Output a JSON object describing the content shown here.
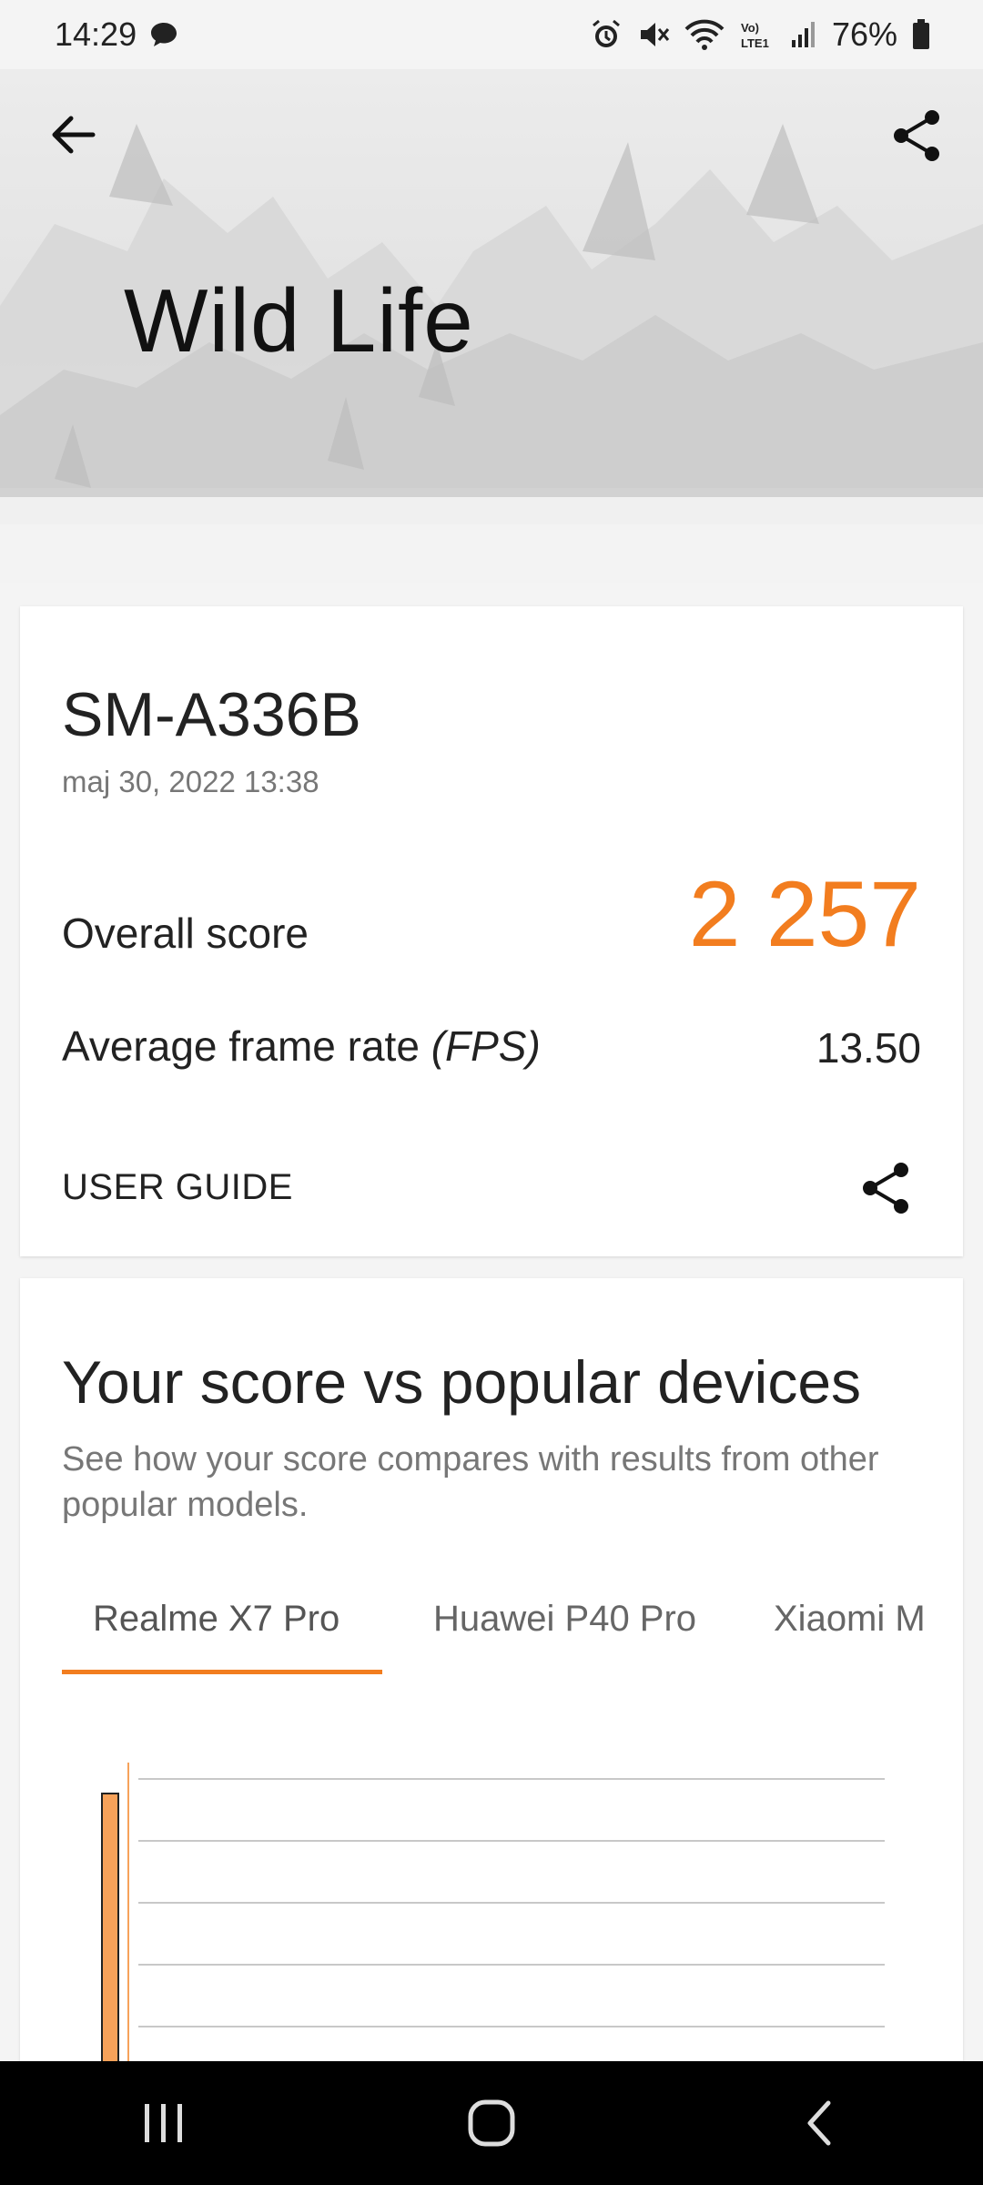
{
  "status_bar": {
    "time": "14:29",
    "battery": "76%",
    "icons": [
      "chat-bubble-icon",
      "alarm-icon",
      "mute-icon",
      "wifi-icon",
      "volte-icon",
      "signal-icon",
      "battery-icon"
    ]
  },
  "hero": {
    "title": "Wild Life",
    "back_icon": "arrow-left-icon",
    "share_icon": "share-icon"
  },
  "result": {
    "device": "SM-A336B",
    "date": "maj 30, 2022 13:38",
    "overall_label": "Overall score",
    "overall_value": "2 257",
    "fps_label_main": "Average frame rate ",
    "fps_label_italic": "(FPS)",
    "fps_value": "13.50",
    "user_guide": "USER GUIDE",
    "accent_color": "#f27d1f"
  },
  "compare": {
    "title": "Your score vs popular devices",
    "description": "See how your score compares with results from other popular models.",
    "tabs": [
      {
        "label": "Realme X7 Pro",
        "active": true
      },
      {
        "label": "Huawei P40 Pro",
        "active": false
      },
      {
        "label": "Xiaomi M",
        "active": false
      }
    ]
  },
  "chart_data": {
    "type": "bar",
    "title": "",
    "xlabel": "",
    "ylabel": "",
    "gridlines": 5,
    "bars": [
      {
        "value": 1.0,
        "color": "#f7a25a"
      },
      {
        "value": 0.13,
        "color": "#f9c9a0"
      }
    ],
    "marker_color": "#f7a25a"
  },
  "nav_bar": {
    "buttons": [
      "recent-apps-icon",
      "home-icon",
      "back-icon"
    ]
  }
}
